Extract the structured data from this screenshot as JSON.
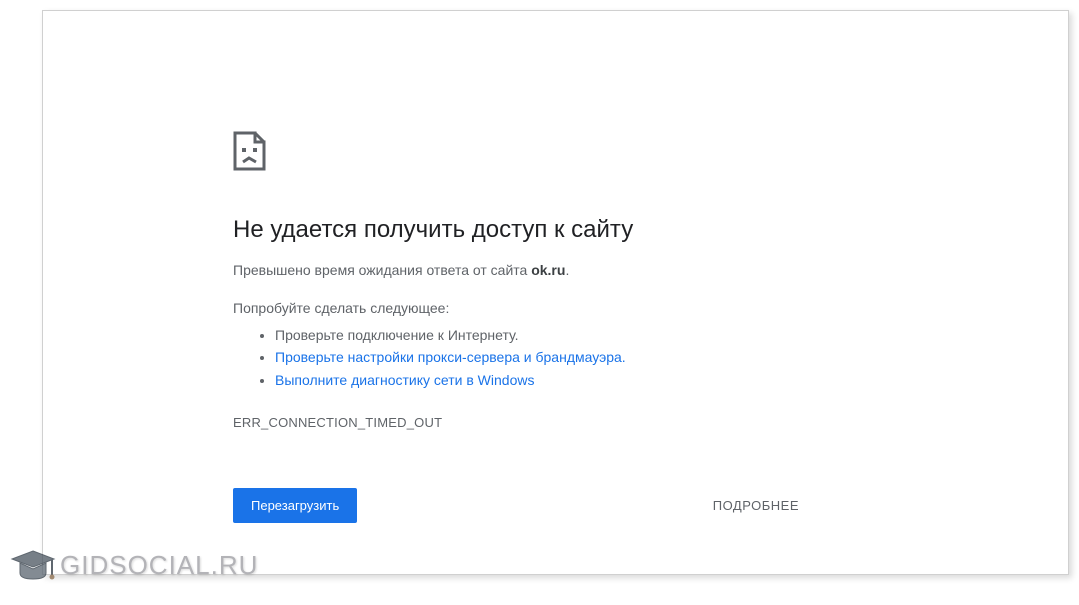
{
  "error": {
    "title": "Не удается получить доступ к сайту",
    "message_prefix": "Превышено время ожидания ответа от сайта ",
    "site": "ok.ru",
    "message_suffix": ".",
    "suggestions_label": "Попробуйте сделать следующее:",
    "suggestions": [
      {
        "text": "Проверьте подключение к Интернету.",
        "link": false
      },
      {
        "text": "Проверьте настройки прокси-сервера и брандмауэра.",
        "link": true
      },
      {
        "text": "Выполните диагностику сети в Windows",
        "link": true
      }
    ],
    "code": "ERR_CONNECTION_TIMED_OUT"
  },
  "buttons": {
    "reload": "Перезагрузить",
    "details": "ПОДРОБНЕЕ"
  },
  "watermark": {
    "text": "GIDSOCIAL.RU"
  }
}
